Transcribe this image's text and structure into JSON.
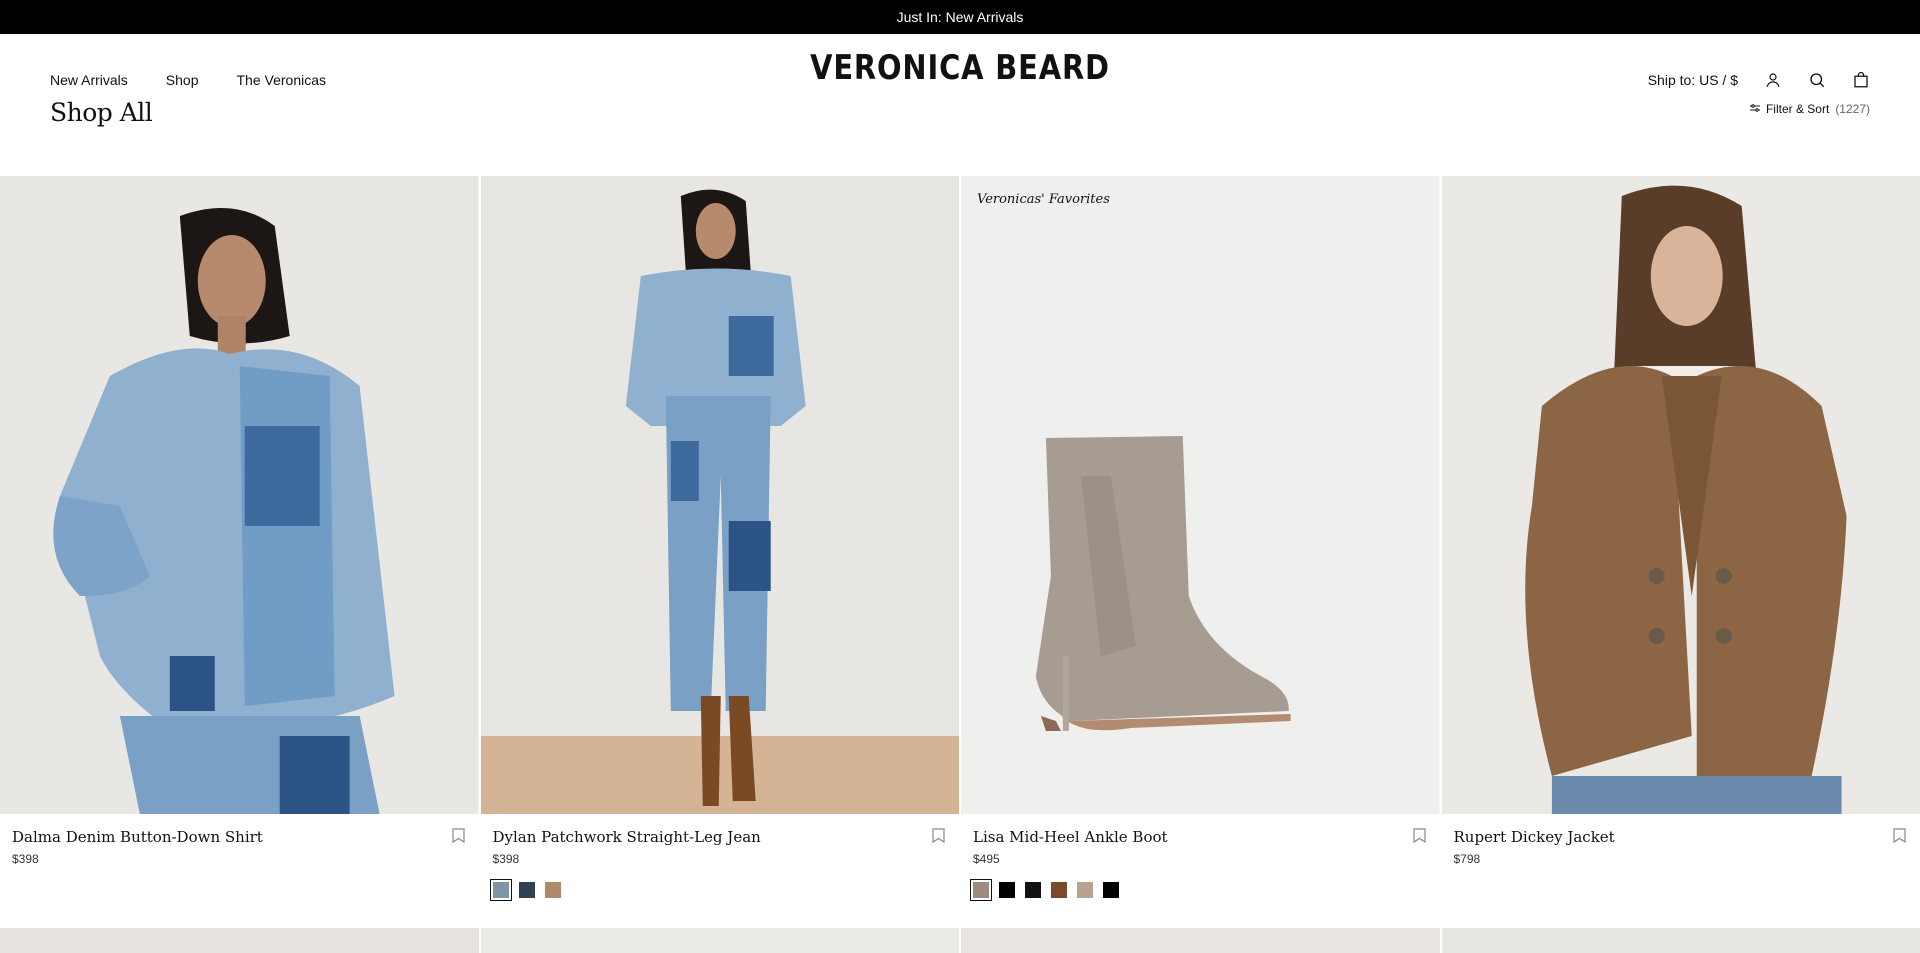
{
  "announcement": "Just In: New Arrivals",
  "nav": {
    "left": [
      "New Arrivals",
      "Shop",
      "The Veronicas"
    ],
    "logo": "VERONICA BEARD",
    "ship_to": "Ship to: US / $"
  },
  "page": {
    "title": "Shop All",
    "filter_label": "Filter & Sort",
    "count": "(1227)"
  },
  "products": [
    {
      "name": "Dalma Denim Button-Down Shirt",
      "price": "$398",
      "badge": "",
      "swatches": []
    },
    {
      "name": "Dylan Patchwork Straight-Leg Jean",
      "price": "$398",
      "badge": "",
      "swatches": [
        "#7f95a6",
        "#2e4257",
        "#b08968"
      ]
    },
    {
      "name": "Lisa Mid-Heel Ankle Boot",
      "price": "$495",
      "badge": "Veronicas' Favorites",
      "swatches": [
        "#9e8b80",
        "#000000",
        "#111111",
        "#7a4a2a",
        "#b9a28f",
        "#000000"
      ]
    },
    {
      "name": "Rupert Dickey Jacket",
      "price": "$798",
      "badge": "",
      "swatches": []
    }
  ]
}
